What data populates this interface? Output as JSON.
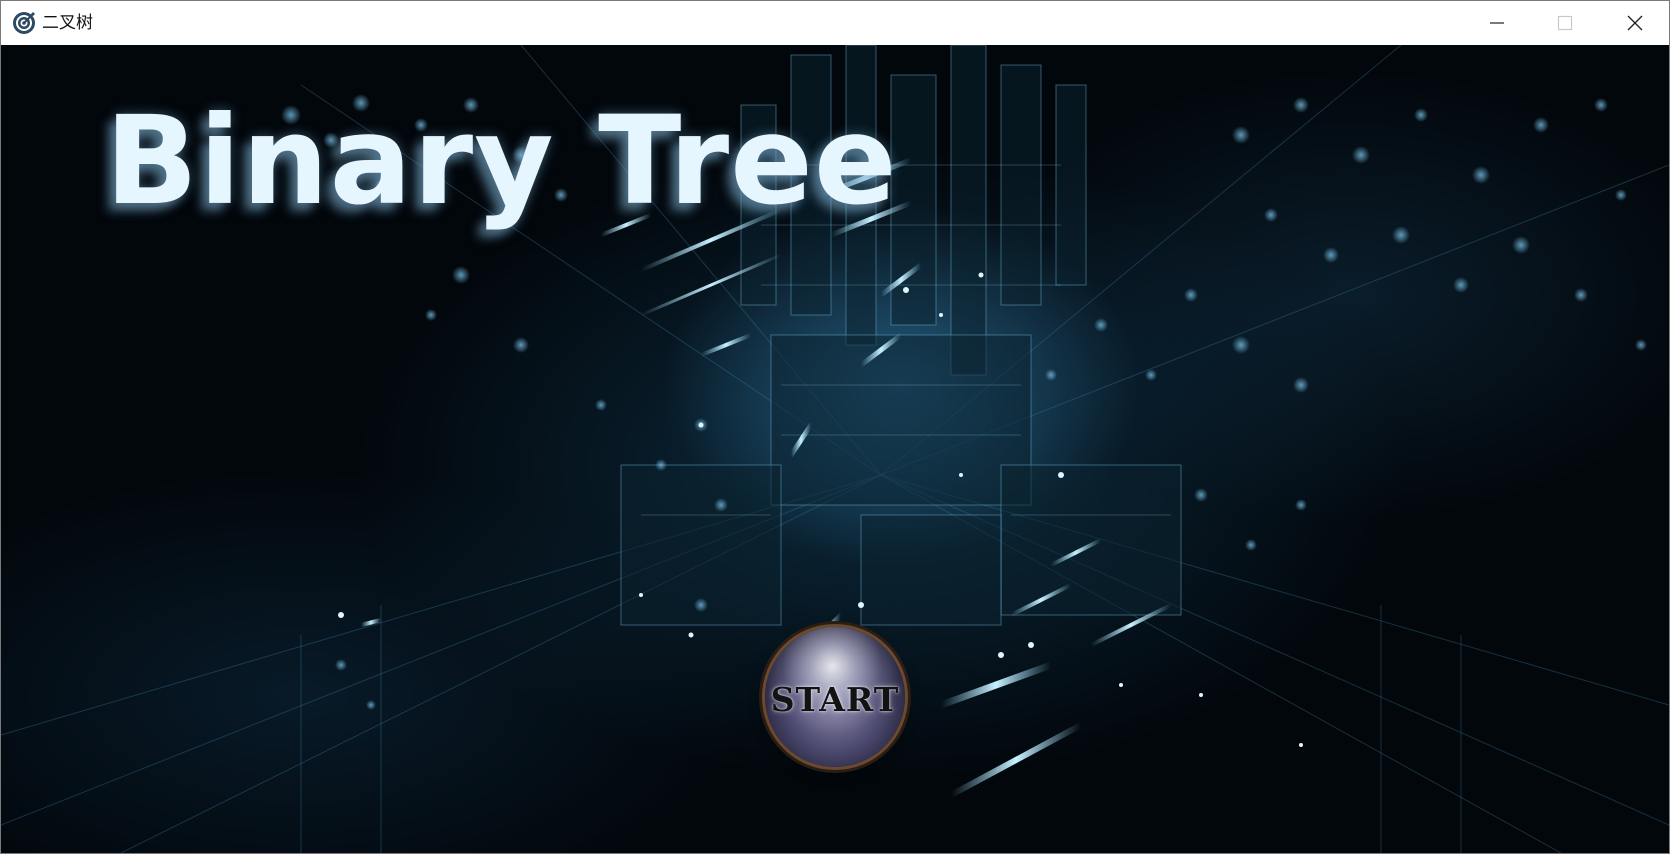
{
  "window": {
    "title": "二叉树",
    "icon": "target-icon",
    "controls": {
      "minimize_icon": "minimize-icon",
      "maximize_icon": "maximize-icon",
      "close_icon": "close-icon"
    }
  },
  "main": {
    "headline": "Binary Tree",
    "start_button_label": "START"
  },
  "colors": {
    "headline": "#e6f6ff",
    "background": "#02070c",
    "accent_glow": "#5ec8ff"
  }
}
